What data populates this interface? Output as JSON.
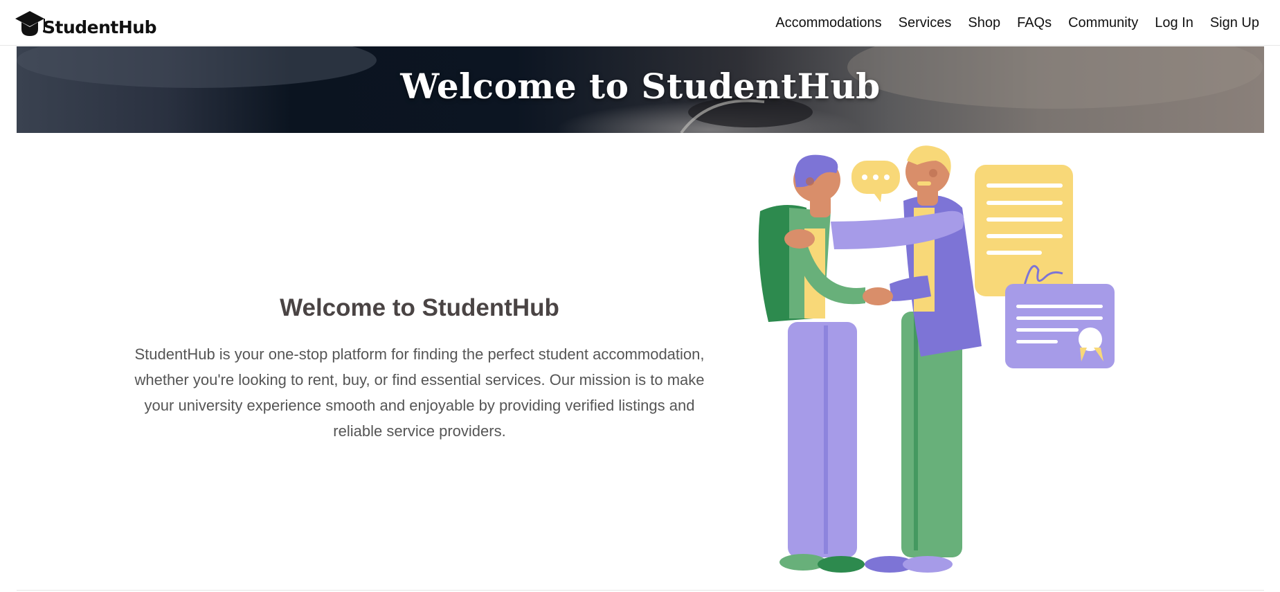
{
  "brand": {
    "name": "StudentHub",
    "logo_icon": "graduation-cap-icon"
  },
  "nav": {
    "items": [
      {
        "label": "Accommodations"
      },
      {
        "label": "Services"
      },
      {
        "label": "Shop"
      },
      {
        "label": "FAQs"
      },
      {
        "label": "Community"
      },
      {
        "label": "Log In"
      },
      {
        "label": "Sign Up"
      }
    ]
  },
  "hero": {
    "title": "Welcome to StudentHub"
  },
  "intro": {
    "heading": "Welcome to StudentHub",
    "text": "StudentHub is your one-stop platform for finding the perfect student accommodation, whether you're looking to rent, buy, or find essential services. Our mission is to make your university experience smooth and enjoyable by providing verified listings and reliable service providers."
  },
  "colors": {
    "purple": "#a69be8",
    "dark_purple": "#7d74d6",
    "green": "#68b07a",
    "dark_green": "#2d8a4e",
    "yellow": "#f8d878",
    "skin": "#d98e6a"
  }
}
